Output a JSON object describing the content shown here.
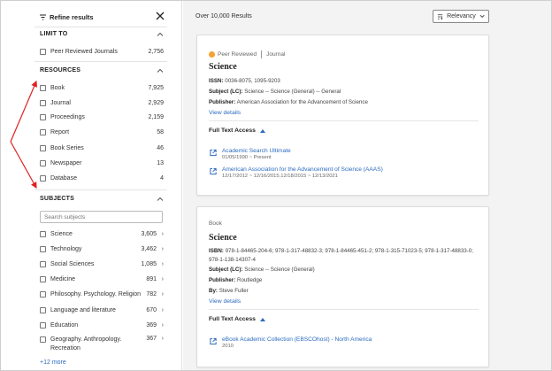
{
  "sidebar": {
    "title": "Refine results",
    "limit_to": {
      "heading": "LIMIT TO",
      "items": [
        {
          "label": "Peer Reviewed Journals",
          "count": "2,756"
        }
      ]
    },
    "resources": {
      "heading": "RESOURCES",
      "items": [
        {
          "label": "Book",
          "count": "7,925"
        },
        {
          "label": "Journal",
          "count": "2,929"
        },
        {
          "label": "Proceedings",
          "count": "2,159"
        },
        {
          "label": "Report",
          "count": "58"
        },
        {
          "label": "Book Series",
          "count": "46"
        },
        {
          "label": "Newspaper",
          "count": "13"
        },
        {
          "label": "Database",
          "count": "4"
        }
      ]
    },
    "subjects": {
      "heading": "SUBJECTS",
      "search_placeholder": "Search subjects",
      "items": [
        {
          "label": "Science",
          "count": "3,605"
        },
        {
          "label": "Technology",
          "count": "3,462"
        },
        {
          "label": "Social Sciences",
          "count": "1,085"
        },
        {
          "label": "Medicine",
          "count": "891"
        },
        {
          "label": "Philosophy. Psychology. Religion",
          "count": "782"
        },
        {
          "label": "Language and literature",
          "count": "670"
        },
        {
          "label": "Education",
          "count": "369"
        },
        {
          "label": "Geography. Anthropology.",
          "label2": "Recreation",
          "count": "367"
        }
      ],
      "more": "+12 more"
    }
  },
  "main": {
    "results_count": "Over 10,000 Results",
    "sort_value": "Relevancy",
    "cards": [
      {
        "peer_reviewed": "Peer Reviewed",
        "type": "Journal",
        "title": "Science",
        "issn_label": "ISSN:",
        "issn": "0036-8075, 1095-9203",
        "subject_label": "Subject (LC):",
        "subject": "Science -- Science (General) -- General",
        "publisher_label": "Publisher:",
        "publisher": "American Association for the Advancement of Science",
        "view_details": "View details",
        "full_text_access": "Full Text Access",
        "sources": [
          {
            "name": "Academic Search Ultimate",
            "dates": "01/05/1990 ~ Present"
          },
          {
            "name": "American Association for the Advancement of Science (AAAS)",
            "dates": "12/17/2012 ~ 12/16/2015,12/18/2015 ~ 12/13/2021"
          }
        ]
      },
      {
        "type": "Book",
        "title": "Science",
        "isbn_label": "ISBN:",
        "isbn_line1": "978-1-84465-204-6; 978-1-317-48832-3; 978-1-84465-451-2; 978-1-315-71023-5; 978-1-317-48833-0;",
        "isbn_line2": "978-1-138-14307-4",
        "subject_label": "Subject (LC):",
        "subject": "Science -- Science (General)",
        "publisher_label": "Publisher:",
        "publisher": "Routledge",
        "by_label": "By:",
        "by": "Steve Fuller",
        "view_details": "View details",
        "full_text_access": "Full Text Access",
        "sources": [
          {
            "name": "eBook Academic Collection (EBSCOhost) - North America",
            "dates": "2010"
          }
        ]
      }
    ]
  },
  "colors": {
    "link": "#2a6bbf",
    "peer_dot": "#f3a233",
    "annotation": "#e02020"
  }
}
